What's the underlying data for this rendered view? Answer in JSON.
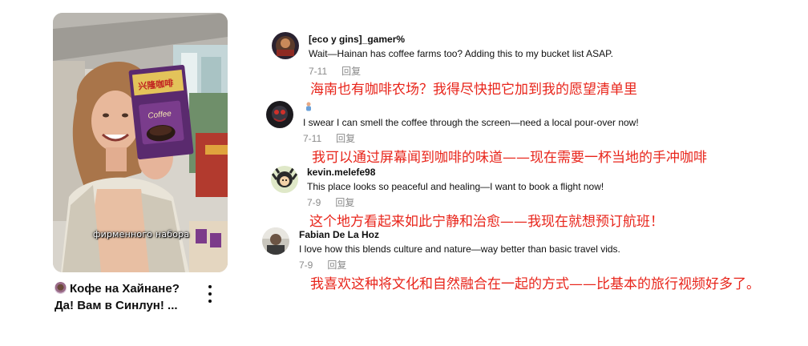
{
  "video": {
    "overlay_caption": "фирменного набора",
    "product_brand": "兴隆咖啡",
    "product_label": "Coffee",
    "title_line1": "Кофе на Хайнане?",
    "title_line2": "Да! Вам в Синлун! ..."
  },
  "comments": [
    {
      "username": "[eco y gins]_gamer%",
      "text": "Wait—Hainan has coffee farms too? Adding this to my bucket list ASAP.",
      "date": "7-11",
      "reply_label": "回复",
      "translation": "海南也有咖啡农场？我得尽快把它加到我的愿望清单里"
    },
    {
      "username": "",
      "text": "I swear I can smell the coffee through the screen—need a local pour-over now!",
      "date": "7-11",
      "reply_label": "回复",
      "translation": "我可以通过屏幕闻到咖啡的味道——现在需要一杯当地的手冲咖啡"
    },
    {
      "username": "kevin.melefe98",
      "text": "This place looks so peaceful and healing—I want to book a flight now!",
      "date": "7-9",
      "reply_label": "回复",
      "translation": "这个地方看起来如此宁静和治愈——我现在就想预订航班！"
    },
    {
      "username": "Fabian De La Hoz",
      "text": "I love how this blends culture and nature—way better than basic travel vids.",
      "date": "7-9",
      "reply_label": "回复",
      "translation": "我喜欢这种将文化和自然融合在一起的方式——比基本的旅行视频好多了。"
    }
  ],
  "colors": {
    "translation": "#e8251b",
    "meta": "#8a8a8a",
    "text": "#0f0f0f"
  },
  "icons": {
    "options": "kebab-menu-icon",
    "emoji_title": "coffee-cup-emoji",
    "emoji_comment2": "person-emoji"
  }
}
